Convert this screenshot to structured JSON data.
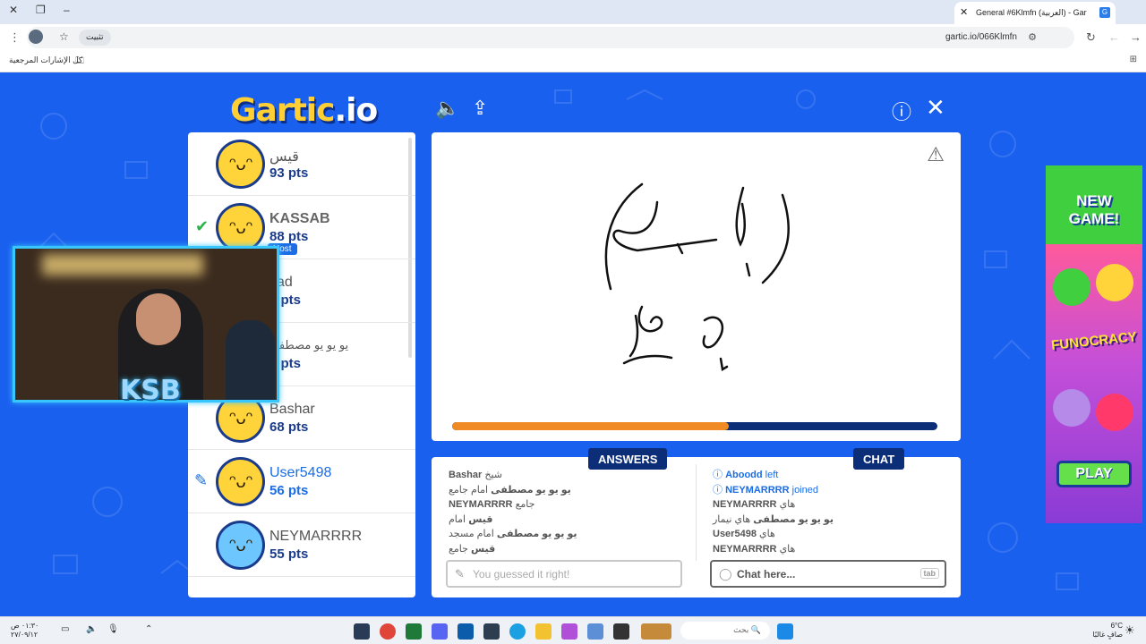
{
  "browser": {
    "tab_title": "General #6Klmfn (العربية) - Gar",
    "url": "gartic.io/066Klmfn",
    "install_label": "تثبيت",
    "bookmarks_label": "كل الإشارات المرجعية"
  },
  "game": {
    "logo_main": "Gartic",
    "logo_suffix": ".io",
    "players": [
      {
        "name": "قيس",
        "points": "93 pts",
        "guessed": false,
        "drawing": false,
        "host": false
      },
      {
        "name": "KASSAB",
        "points": "88 pts",
        "guessed": true,
        "drawing": false,
        "host": true
      },
      {
        "name": "yad",
        "points": "2 pts",
        "guessed": false,
        "drawing": false,
        "host": false
      },
      {
        "name": "يو يو يو مصطفى",
        "points": "0 pts",
        "guessed": false,
        "drawing": false,
        "host": false
      },
      {
        "name": "Bashar",
        "points": "68 pts",
        "guessed": false,
        "drawing": false,
        "host": false
      },
      {
        "name": "User5498",
        "points": "56 pts",
        "guessed": false,
        "drawing": true,
        "host": false
      },
      {
        "name": "NEYMARRRR",
        "points": "55 pts",
        "guessed": false,
        "drawing": false,
        "host": false
      }
    ],
    "host_label": "Host",
    "webcam_overlay": "KSB",
    "timer_progress_fraction": 0.57,
    "answers_label": "ANSWERS",
    "chat_label": "CHAT",
    "answers": [
      {
        "user": "Bashar",
        "text": "شيخ"
      },
      {
        "user": "يو يو يو مصطفى",
        "text": "امام جامع"
      },
      {
        "user": "NEYMARRRR",
        "text": "جامع"
      },
      {
        "user": "قيس",
        "text": "امام"
      },
      {
        "user": "يو يو يو مصطفى",
        "text": "امام مسجد"
      },
      {
        "user": "قيس",
        "text": "جامع"
      }
    ],
    "chat": [
      {
        "user": "Aboodd",
        "text": "left",
        "system": true
      },
      {
        "user": "NEYMARRRR",
        "text": "joined",
        "system": true
      },
      {
        "user": "NEYMARRRR",
        "text": "هاي",
        "system": false
      },
      {
        "user": "يو يو يو مصطفى",
        "text": "هاي نيمار",
        "system": false
      },
      {
        "user": "User5498",
        "text": "هاي",
        "system": false
      },
      {
        "user": "NEYMARRRR",
        "text": "هاي",
        "system": false
      }
    ],
    "answer_input_placeholder": "You guessed it right!",
    "chat_input_placeholder": "Chat here...",
    "tab_key": "tab"
  },
  "ad": {
    "headline": "NEW GAME!",
    "brand": "FUNOCRACY",
    "play_label": "PLAY"
  },
  "taskbar": {
    "time": "٠١:٣٠ ص",
    "date": "٢٧/٠٩/١٢",
    "search_placeholder": "بحث",
    "weather_temp": "6°C",
    "weather_desc": "صافٍ غالبًا"
  }
}
